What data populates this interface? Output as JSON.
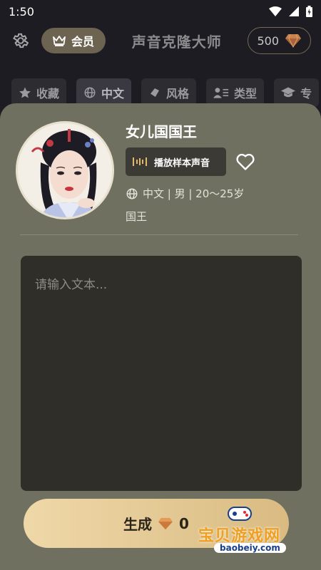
{
  "status_bar": {
    "time": "1:50"
  },
  "header": {
    "vip_label": "会员",
    "title": "声音克隆大师",
    "coins": "500"
  },
  "tabs": [
    {
      "label": "收藏",
      "icon": "star-icon"
    },
    {
      "label": "中文",
      "icon": "globe-icon",
      "active": true
    },
    {
      "label": "风格",
      "icon": "tag-icon"
    },
    {
      "label": "类型",
      "icon": "person-list-icon"
    },
    {
      "label": "专",
      "icon": "graduation-cap-icon"
    }
  ],
  "voice": {
    "name": "女儿国国王",
    "play_label": "播放样本声音",
    "meta": "中文 | 男 | 20～25岁",
    "tag": "国王"
  },
  "editor": {
    "placeholder": "请输入文本..."
  },
  "generate": {
    "label": "生成",
    "cost": "0"
  },
  "watermark": {
    "text": "宝贝游戏网",
    "url": "baobeiy.com"
  },
  "colors": {
    "sheet": "#707060",
    "accent_gold": "#d9bb82",
    "textbox": "#2f2e28",
    "background": "#1c1c22"
  }
}
